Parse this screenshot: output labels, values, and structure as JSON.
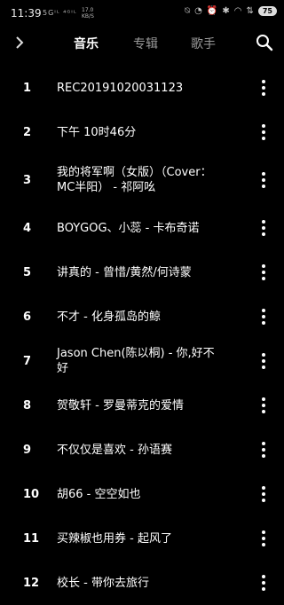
{
  "status_bar": {
    "time": "11:39",
    "signal": "5Gᴵᴸ ⁴ᴳᴵᴸ",
    "net_speed": "17.0",
    "net_unit": "KB/S",
    "battery": "75"
  },
  "nav": {
    "tabs": [
      {
        "label": "音乐",
        "active": true
      },
      {
        "label": "专辑",
        "active": false
      },
      {
        "label": "歌手",
        "active": false
      }
    ]
  },
  "songs": [
    {
      "num": "1",
      "title": "REC20191020031123"
    },
    {
      "num": "2",
      "title": "下午 10时46分"
    },
    {
      "num": "3",
      "title": "我的将军啊（女版）（Cover：MC半阳） - 祁阿吆"
    },
    {
      "num": "4",
      "title": "BOYGOG、小蕊 - 卡布奇诺"
    },
    {
      "num": "5",
      "title": "讲真的 - 曾惜/黄然/何诗蒙"
    },
    {
      "num": "6",
      "title": "不才 - 化身孤岛的鲸"
    },
    {
      "num": "7",
      "title": "Jason Chen(陈以桐) - 你,好不好"
    },
    {
      "num": "8",
      "title": "贺敬轩 - 罗曼蒂克的爱情"
    },
    {
      "num": "9",
      "title": "不仅仅是喜欢 - 孙语赛"
    },
    {
      "num": "10",
      "title": "胡66 - 空空如也"
    },
    {
      "num": "11",
      "title": "买辣椒也用券 - 起风了"
    },
    {
      "num": "12",
      "title": "校长 - 带你去旅行"
    }
  ]
}
